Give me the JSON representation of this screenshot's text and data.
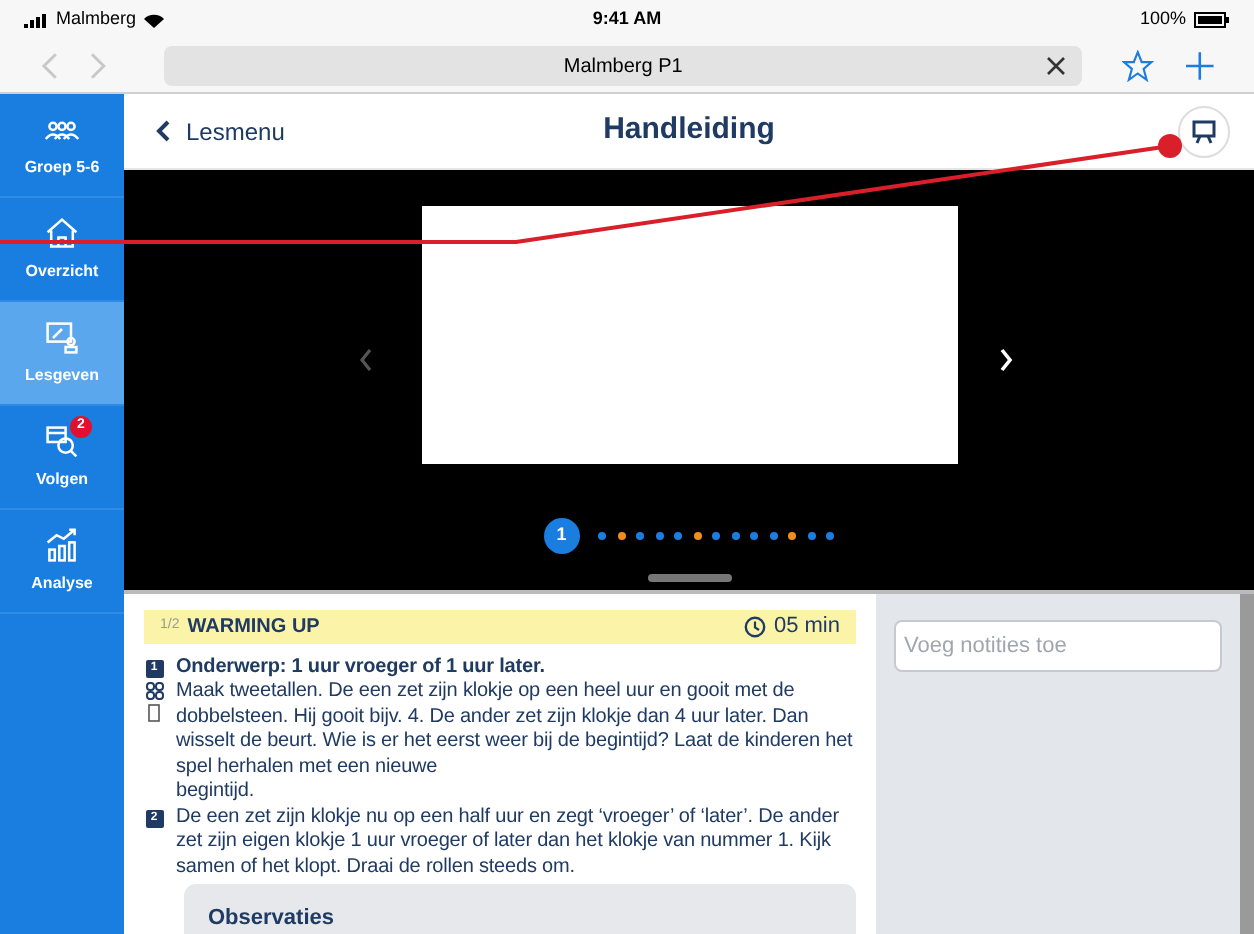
{
  "status_bar": {
    "carrier": "Malmberg",
    "time": "9:41 AM",
    "battery": "100%"
  },
  "browser": {
    "url": "Malmberg P1"
  },
  "sidebar": {
    "items": [
      {
        "kind": "group",
        "label": "Groep 5-6",
        "selected": false
      },
      {
        "kind": "home",
        "label": "Overzicht",
        "selected": false
      },
      {
        "kind": "teach",
        "label": "Lesgeven",
        "selected": true
      },
      {
        "kind": "follow",
        "label": "Volgen",
        "selected": false,
        "badge": "2"
      },
      {
        "kind": "analyse",
        "label": "Analyse",
        "selected": false
      }
    ]
  },
  "header": {
    "back": "Lesmenu",
    "title": "Handleiding"
  },
  "slides": {
    "current": "1",
    "dots": [
      {
        "color": "#1a7de0"
      },
      {
        "color": "#f28c1e"
      },
      {
        "color": "#1a7de0"
      },
      {
        "color": "#1a7de0"
      },
      {
        "color": "#1a7de0"
      },
      {
        "color": "#f28c1e"
      },
      {
        "color": "#1a7de0"
      },
      {
        "color": "#1a7de0"
      },
      {
        "color": "#1a7de0"
      },
      {
        "color": "#1a7de0"
      },
      {
        "color": "#f28c1e"
      },
      {
        "color": "#1a7de0"
      },
      {
        "color": "#1a7de0"
      }
    ]
  },
  "section": {
    "step": "1/2",
    "title": "WARMING UP",
    "duration": "05 min"
  },
  "steps": [
    {
      "number": "1",
      "text": "**Onderwerp: 1 uur vroeger of 1 uur later.**\nMaak tweetallen. De een zet zijn klokje op een heel uur en gooit met de dobbelsteen. Hij gooit bijv. 4. De ander zet zijn klokje dan 4 uur later. Dan wisselt de beurt. Wie is er het eerst weer bij de begintijd? Laat de kinderen het spel herhalen met een nieuwe\nbegintijd."
    },
    {
      "number": "2",
      "text": "De een zet zijn klokje nu op een half uur en zegt ‘vroeger’ of ‘later’. De ander zet zijn eigen klokje 1 uur vroeger of later dan het klokje van nummer 1. Kijk samen of het klopt. Draai de rollen steeds om."
    }
  ],
  "observations": {
    "title": "Observaties"
  },
  "notes": {
    "placeholder": "Voeg notities toe"
  }
}
